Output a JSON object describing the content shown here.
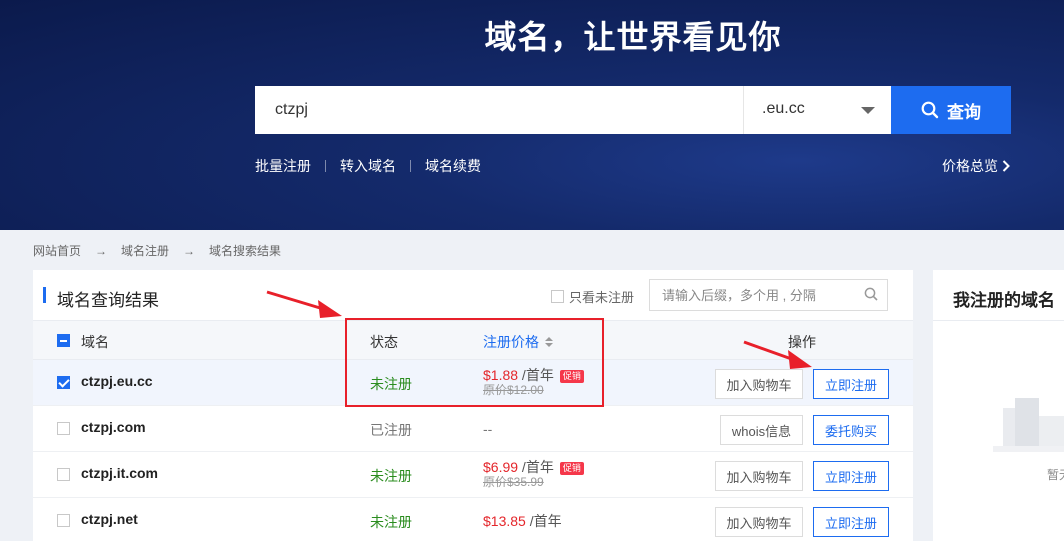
{
  "hero": {
    "title": "域名，让世界看见你",
    "search_value": "ctzpj",
    "tld_selected": ".eu.cc",
    "search_button": "查询",
    "links": [
      "批量注册",
      "转入域名",
      "域名续费"
    ],
    "price_overview": "价格总览"
  },
  "breadcrumb": [
    "网站首页",
    "域名注册",
    "域名搜索结果"
  ],
  "breadcrumb_arrow": "→",
  "results": {
    "title": "域名查询结果",
    "only_unregistered_label": "只看未注册",
    "filter_placeholder": "请输入后缀，多个用 , 分隔",
    "columns": {
      "domain": "域名",
      "status": "状态",
      "price": "注册价格",
      "actions": "操作"
    },
    "rows": [
      {
        "domain": "ctzpj.eu.cc",
        "checked": true,
        "status": "未注册",
        "price": "$1.88",
        "per": " /首年",
        "tag": "促销",
        "original": "原价$12.00",
        "btn1": "加入购物车",
        "btn2": "立即注册"
      },
      {
        "domain": "ctzpj.com",
        "checked": false,
        "status": "已注册",
        "price": "--",
        "per": "",
        "tag": "",
        "original": "",
        "btn1": "whois信息",
        "btn2": "委托购买"
      },
      {
        "domain": "ctzpj.it.com",
        "checked": false,
        "status": "未注册",
        "price": "$6.99",
        "per": " /首年",
        "tag": "促销",
        "original": "原价$35.99",
        "btn1": "加入购物车",
        "btn2": "立即注册"
      },
      {
        "domain": "ctzpj.net",
        "checked": false,
        "status": "未注册",
        "price": "$13.85",
        "per": " /首年",
        "tag": "",
        "original": "",
        "btn1": "加入购物车",
        "btn2": "立即注册"
      }
    ]
  },
  "side": {
    "title": "我注册的域名",
    "empty_text": "暂无"
  },
  "colors": {
    "accent": "#1d6cf0",
    "price": "#e4262b",
    "free": "#2a8c1e",
    "annotation": "#e8202a"
  }
}
